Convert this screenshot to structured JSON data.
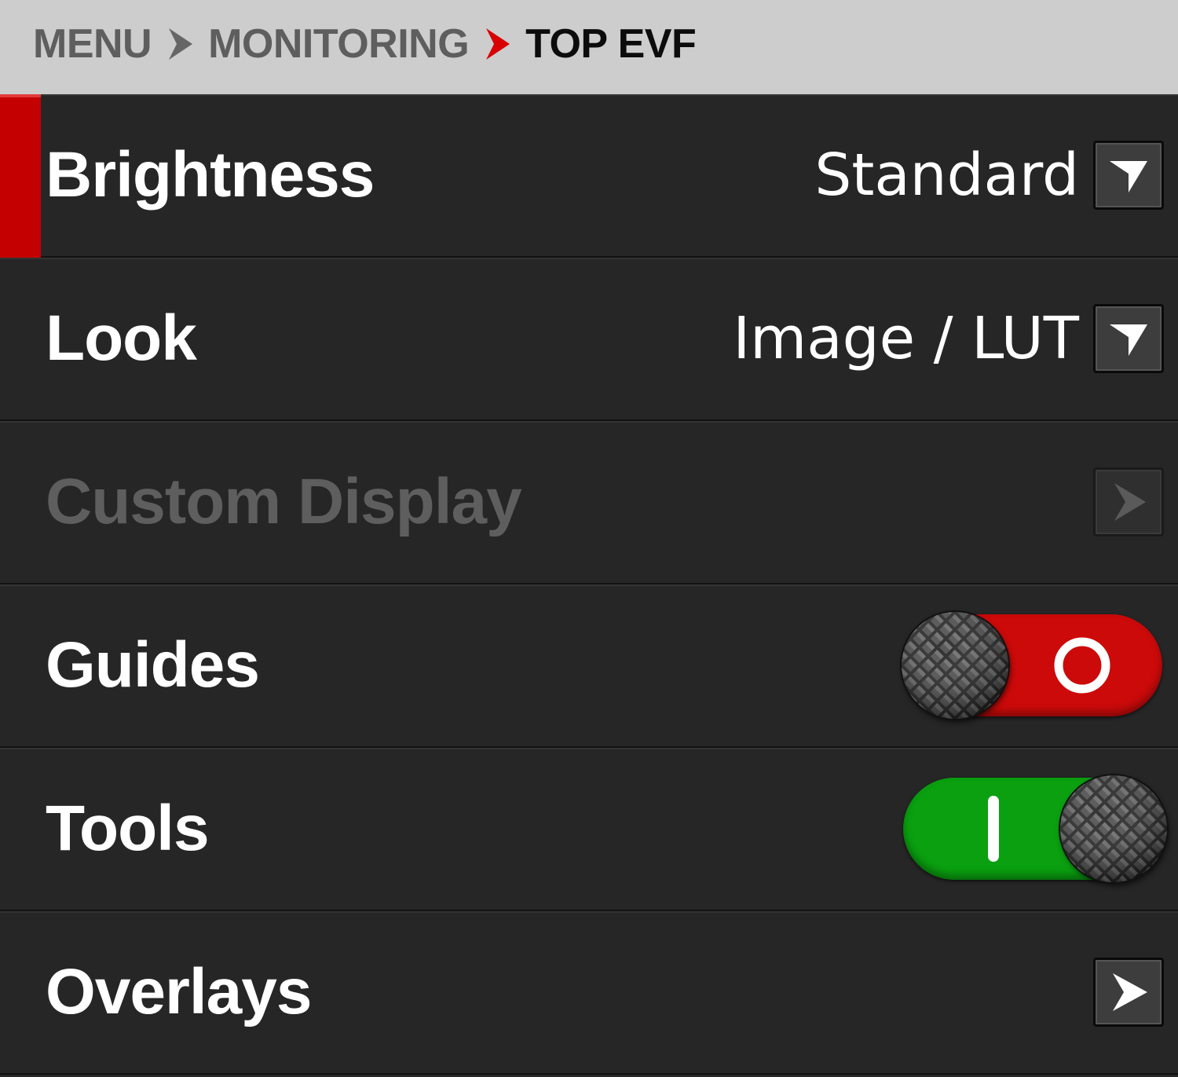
{
  "breadcrumb": {
    "items": [
      {
        "label": "MENU"
      },
      {
        "label": "MONITORING"
      },
      {
        "label": "TOP EVF"
      }
    ]
  },
  "menu": {
    "brightness": {
      "label": "Brightness",
      "value": "Standard",
      "selected": true
    },
    "look": {
      "label": "Look",
      "value": "Image / LUT"
    },
    "custom_display": {
      "label": "Custom Display",
      "enabled": false
    },
    "guides": {
      "label": "Guides",
      "toggle_state": "off"
    },
    "tools": {
      "label": "Tools",
      "toggle_state": "on"
    },
    "overlays": {
      "label": "Overlays"
    }
  },
  "colors": {
    "header_bg": "#cdcdcd",
    "row_bg": "#262626",
    "accent_red": "#c40000",
    "toggle_off": "#cc0a0a",
    "toggle_on": "#0aa010",
    "disabled_text": "#5e5e5e"
  },
  "icons": {
    "breadcrumb_separator": "chevron-right-icon",
    "dropdown": "triangle-down-icon",
    "submenu": "triangle-right-icon",
    "toggle_off_mark": "circle-o-icon",
    "toggle_on_mark": "bar-i-icon"
  }
}
